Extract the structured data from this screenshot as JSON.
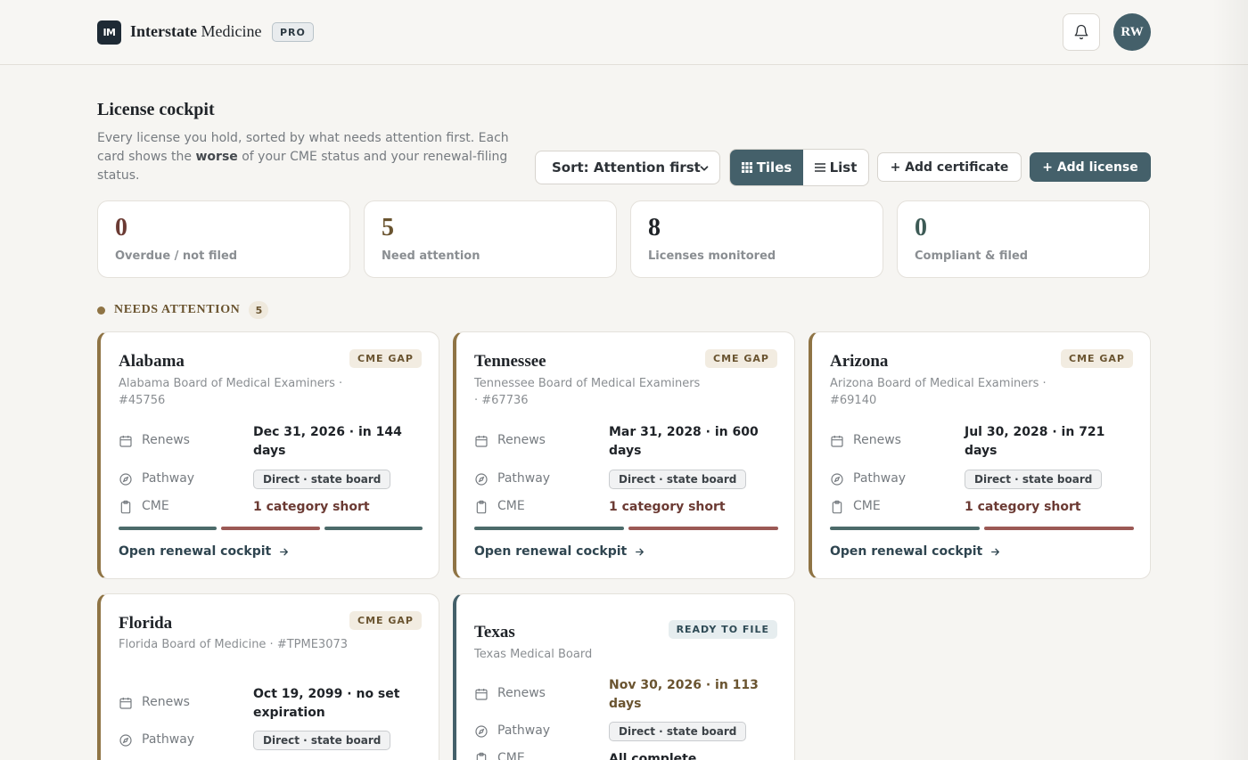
{
  "header": {
    "logo_text": "IM",
    "brand_bold": "Interstate",
    "brand_rest": " Medicine",
    "plan_badge": "PRO",
    "avatar_initials": "RW"
  },
  "page": {
    "title": "License cockpit",
    "desc_start": "Every license you hold, sorted by what needs attention first. Each card shows the ",
    "desc_bold": "worse",
    "desc_end": " of your CME status and your renewal-filing status."
  },
  "toolbar": {
    "sort_label": "Sort: Attention first",
    "view_tiles": "Tiles",
    "view_list": "List",
    "add_certificate": "+ Add certificate",
    "add_license": "+ Add license"
  },
  "stats": [
    {
      "value": "0",
      "label": "Overdue / not filed",
      "color": "#6b3a33"
    },
    {
      "value": "5",
      "label": "Need attention",
      "color": "#6a5430"
    },
    {
      "value": "8",
      "label": "Licenses monitored",
      "color": "#1f2328"
    },
    {
      "value": "0",
      "label": "Compliant & filed",
      "color": "#3c5a55"
    }
  ],
  "section": {
    "label": "NEEDS ATTENTION",
    "count": "5"
  },
  "row_labels": {
    "renews": "Renews",
    "pathway": "Pathway",
    "cme": "CME"
  },
  "open_link": "Open renewal cockpit",
  "cards": [
    {
      "state": "Alabama",
      "badge": "CME GAP",
      "board": "Alabama Board of Medical Examiners · #45756",
      "renews": "Dec 31, 2026 · in 144 days",
      "pathway": "Direct · state board",
      "cme": "1 category short",
      "bars": [
        "ok",
        "bad",
        "ok"
      ]
    },
    {
      "state": "Tennessee",
      "badge": "CME GAP",
      "board": "Tennessee Board of Medical Examiners · #67736",
      "renews": "Mar 31, 2028 · in 600 days",
      "pathway": "Direct · state board",
      "cme": "1 category short",
      "bars": [
        "ok",
        "bad"
      ]
    },
    {
      "state": "Arizona",
      "badge": "CME GAP",
      "board": "Arizona Board of Medical Examiners · #69140",
      "renews": "Jul 30, 2028 · in 721 days",
      "pathway": "Direct · state board",
      "cme": "1 category short",
      "bars": [
        "ok",
        "bad"
      ]
    },
    {
      "state": "Florida",
      "badge": "CME GAP",
      "board": "Florida Board of Medicine · #TPME3073",
      "renews": "Oct 19, 2099 · no set expiration",
      "pathway": "Direct · state board"
    },
    {
      "state": "Texas",
      "badge": "READY TO FILE",
      "board": "Texas Medical Board",
      "renews": "Nov 30, 2026 · in 113 days",
      "pathway": "Direct · state board",
      "cme": "All complete"
    }
  ]
}
